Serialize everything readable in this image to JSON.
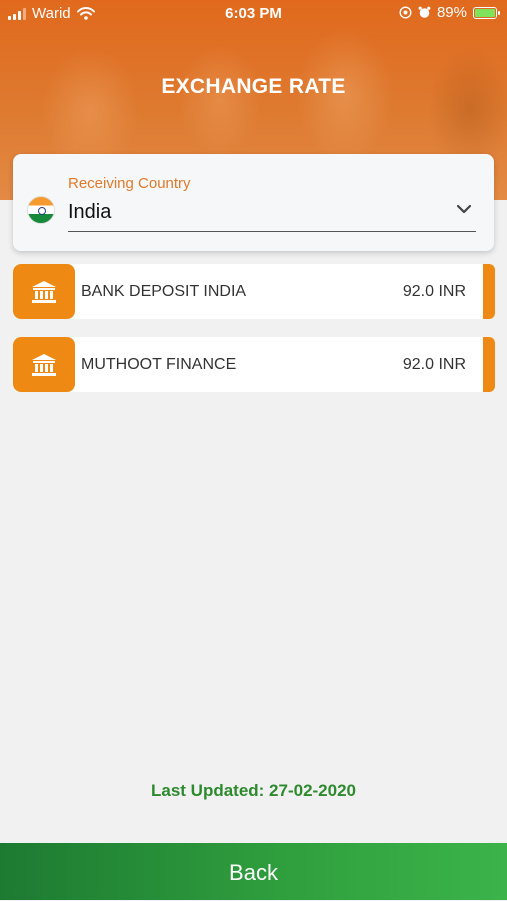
{
  "status_bar": {
    "carrier": "Warid",
    "time": "6:03 PM",
    "battery": "89%",
    "battery_level": 0.89
  },
  "header": {
    "title": "EXCHANGE RATE"
  },
  "country_selector": {
    "label": "Receiving Country",
    "value": "India",
    "flag_icon": "india-flag-icon"
  },
  "rates": [
    {
      "name": "BANK DEPOSIT INDIA",
      "rate": "92.0 INR",
      "icon": "bank-icon"
    },
    {
      "name": "MUTHOOT FINANCE",
      "rate": "92.0 INR",
      "icon": "bank-icon"
    }
  ],
  "footer": {
    "last_updated": "Last Updated: 27-02-2020",
    "back_label": "Back"
  },
  "colors": {
    "accent_orange": "#ee8a14",
    "header_orange": "#e0691d",
    "label_orange": "#e27a2a",
    "green": "#2e8a2e",
    "background": "#f1f1f1"
  }
}
